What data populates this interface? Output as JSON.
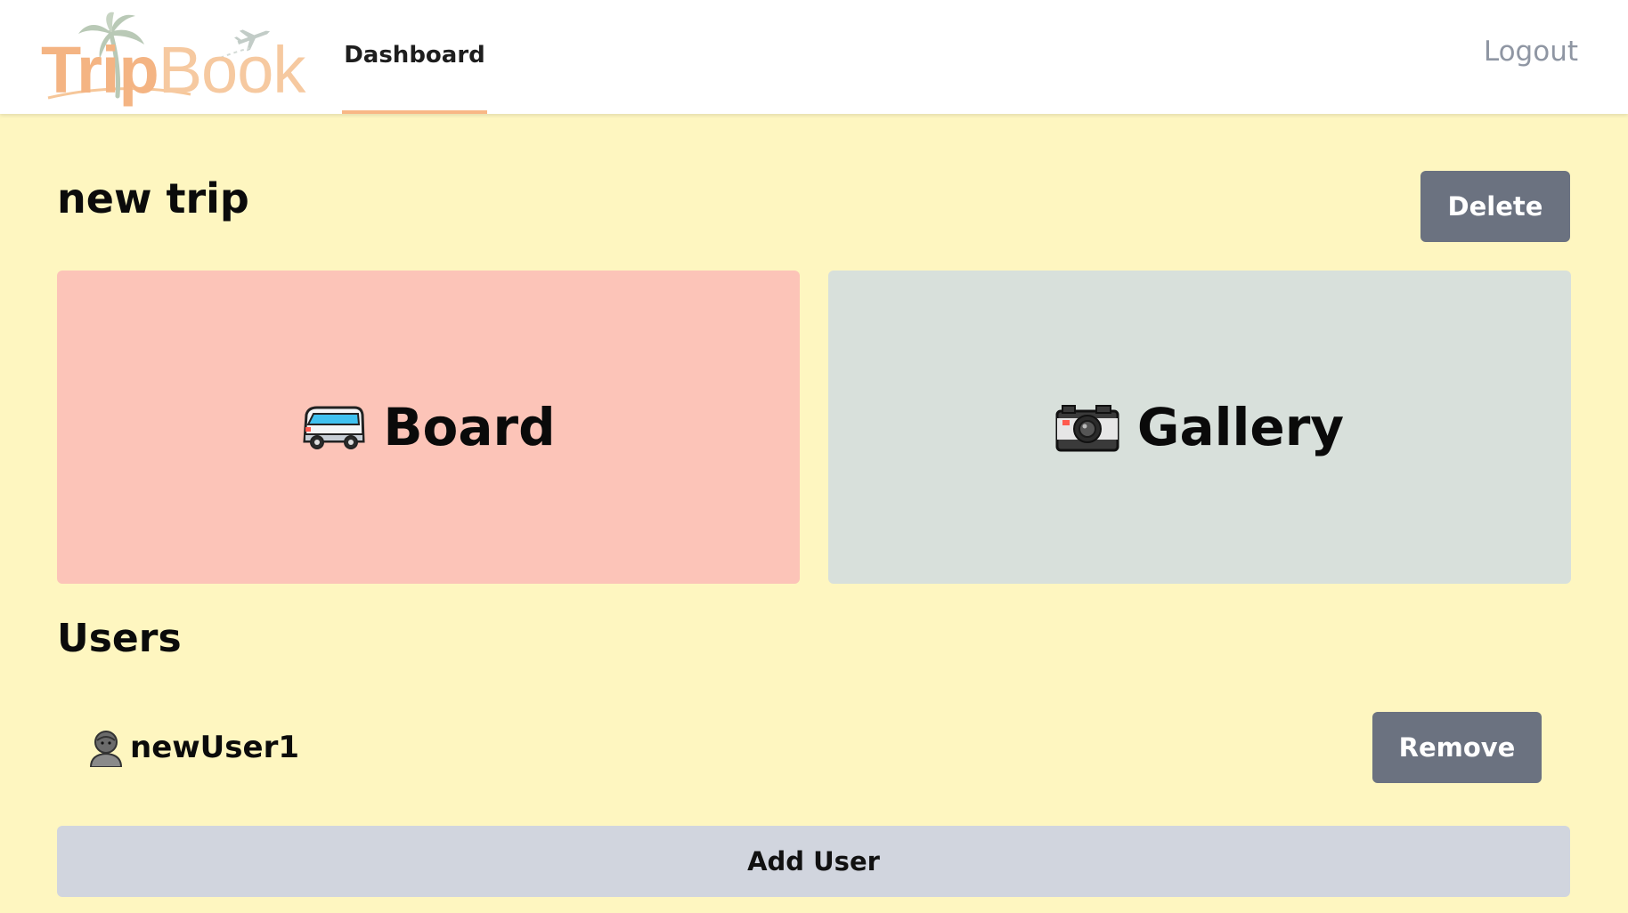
{
  "header": {
    "logo": {
      "part1": "Trip",
      "part2": "Book",
      "icon": "palm-tree-airplane-logo"
    },
    "nav": [
      {
        "label": "Dashboard",
        "active": true
      }
    ],
    "logout_label": "Logout"
  },
  "trip": {
    "title": "new trip",
    "delete_label": "Delete"
  },
  "cards": [
    {
      "label": "Board",
      "icon": "minibus-icon",
      "color": "#fcc4b8"
    },
    {
      "label": "Gallery",
      "icon": "camera-icon",
      "color": "#d8e0db"
    }
  ],
  "users": {
    "title": "Users",
    "list": [
      {
        "name": "newUser1",
        "icon": "person-icon",
        "remove_label": "Remove"
      }
    ],
    "add_label": "Add User"
  },
  "colors": {
    "background": "#fef6c0",
    "accent": "#f8b786",
    "button_gray": "#6b7280",
    "add_button": "#d1d5de"
  }
}
